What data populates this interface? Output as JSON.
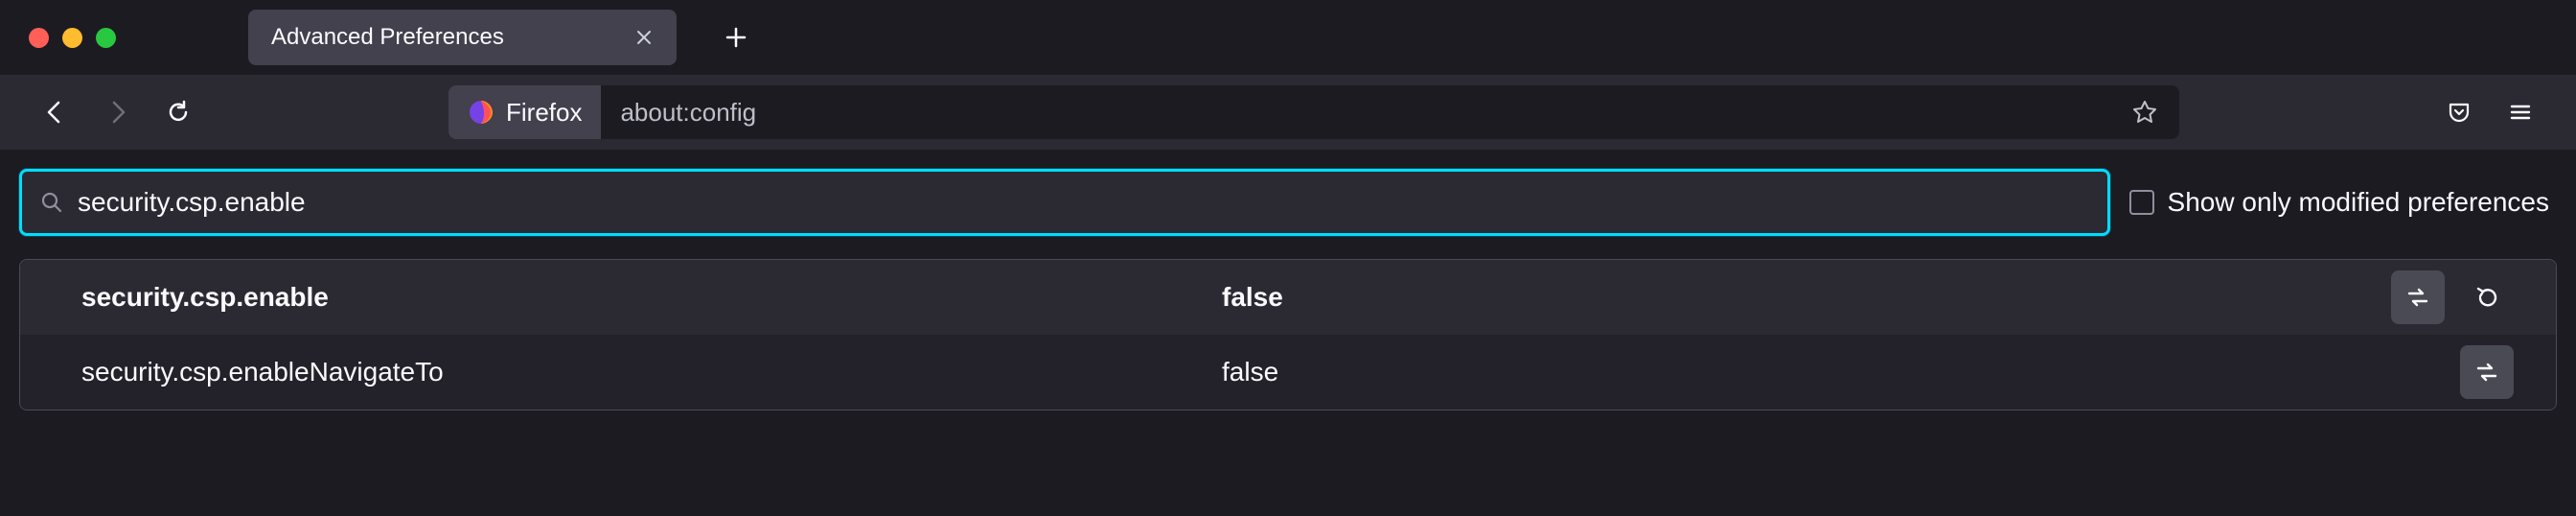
{
  "window": {
    "tab_title": "Advanced Preferences"
  },
  "toolbar": {
    "identity_label": "Firefox",
    "url": "about:config"
  },
  "search": {
    "value": "security.csp.enable",
    "checkbox_label": "Show only modified preferences"
  },
  "prefs": [
    {
      "name": "security.csp.enable",
      "value": "false",
      "modified": true,
      "has_reset": true
    },
    {
      "name": "security.csp.enableNavigateTo",
      "value": "false",
      "modified": false,
      "has_reset": false
    }
  ]
}
